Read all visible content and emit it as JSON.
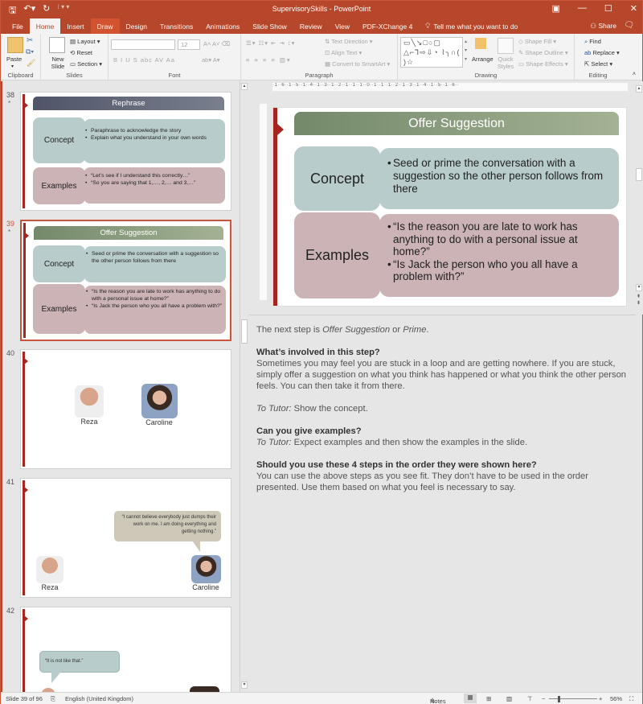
{
  "window": {
    "title": "SupervisorySkills  -  PowerPoint",
    "qat": {
      "save_icon": "save-icon",
      "undo_icon": "undo-icon",
      "redo_icon": "redo-icon"
    },
    "controls": {
      "restore": "▣",
      "minimize": "—",
      "maximize": "☐",
      "close": "✕"
    }
  },
  "tabs": [
    "File",
    "Home",
    "Insert",
    "Draw",
    "Design",
    "Transitions",
    "Animations",
    "Slide Show",
    "Review",
    "View",
    "PDF-XChange 4"
  ],
  "active_tab": "Home",
  "tell_me": "Tell me what you want to do",
  "share": "Share",
  "ribbon": {
    "clipboard": {
      "label": "Clipboard",
      "paste": "Paste"
    },
    "slides": {
      "label": "Slides",
      "new_slide": "New Slide",
      "layout": "Layout",
      "reset": "Reset",
      "section": "Section"
    },
    "font": {
      "label": "Font",
      "font_name": "",
      "font_size": "12",
      "row2": "B  I  U  S  abc  AV  Aa"
    },
    "paragraph": {
      "label": "Paragraph",
      "text_direction": "Text Direction",
      "align_text": "Align Text",
      "convert_smartart": "Convert to SmartArt"
    },
    "drawing": {
      "label": "Drawing",
      "arrange": "Arrange",
      "quick_styles": "Quick Styles",
      "shape_fill": "Shape Fill",
      "shape_outline": "Shape Outline",
      "shape_effects": "Shape Effects",
      "shapes_glyphs": "▭╲↘□○▢ △⌐⅂⇨⇩◔ ⌇╮∩( )☆"
    },
    "editing": {
      "label": "Editing",
      "find": "Find",
      "replace": "Replace",
      "select": "Select"
    }
  },
  "thumbnails": [
    {
      "num": "38",
      "star": "*",
      "title": "Rephrase",
      "concept_label": "Concept",
      "concept_bullets": [
        "Paraphrase to acknowledge the story",
        "Explain what you understand in your own words"
      ],
      "examples_label": "Examples",
      "examples_bullets": [
        "“Let’s see if I understand this correctly…”",
        "“So you are saying that 1,…, 2,… and 3,…”"
      ]
    },
    {
      "num": "39",
      "star": "*",
      "title": "Offer Suggestion",
      "concept_label": "Concept",
      "concept_bullets": [
        "Seed or prime the conversation with a suggestion so the other person follows from there"
      ],
      "examples_label": "Examples",
      "examples_bullets": [
        "“Is the reason you are late to work has anything to do with a personal issue at home?”",
        "“Is Jack the person who you all have a problem with?”"
      ]
    },
    {
      "num": "40",
      "people": [
        "Reza",
        "Caroline"
      ]
    },
    {
      "num": "41",
      "bubble": "“I cannot believe everybody just dumps their work on me. I am doing everything and getting nothing.”",
      "people": [
        "Reza",
        "Caroline"
      ]
    },
    {
      "num": "42",
      "bubble": "“It is not like that.”"
    }
  ],
  "slide": {
    "title": "Offer Suggestion",
    "concept_label": "Concept",
    "concept_bullets": [
      "Seed or prime the conversation with a suggestion so the other person follows from there"
    ],
    "examples_label": "Examples",
    "examples_bullets": [
      "“Is the reason you are late to work has anything to do with a personal issue at home?”",
      "“Is Jack the person who you all have a problem with?”"
    ]
  },
  "ruler": {
    "h": "·1··6··1··5··1··4··1··3··1··2··1··1··1··0··1··1··1··2··1··3··1··4··1··5··1··6··"
  },
  "notes": {
    "intro_a": "The next step is ",
    "intro_b": "Offer Suggestion",
    "intro_c": " or ",
    "intro_d": "Prime",
    "intro_e": ".",
    "q1": "What’s involved in this step?",
    "a1": "Sometimes you may feel you are stuck in a loop and are getting nowhere. If you are stuck, simply offer a suggestion on what you think has happened or what you think the other person feels. You can then take it from there.",
    "tutor1_label": "To Tutor:",
    "tutor1": " Show the concept.",
    "q2": "Can you give examples?",
    "tutor2_label": "To Tutor:",
    "tutor2": " Expect examples and then show the examples in the slide.",
    "q3": "Should you use these 4 steps in the order they were shown here?",
    "a3": "You can use the above steps as you see fit. They don’t have to be used in the order presented. Use them based on what you feel is necessary to say."
  },
  "status": {
    "slide_of": "Slide 39 of 96",
    "language": "English (United Kingdom)",
    "notes": "Notes",
    "zoom": "56%"
  },
  "colors": {
    "accent": "#b7472a",
    "slide_red": "#a6261f",
    "concept": "#b7cccb",
    "examples": "#cbb3b6"
  }
}
